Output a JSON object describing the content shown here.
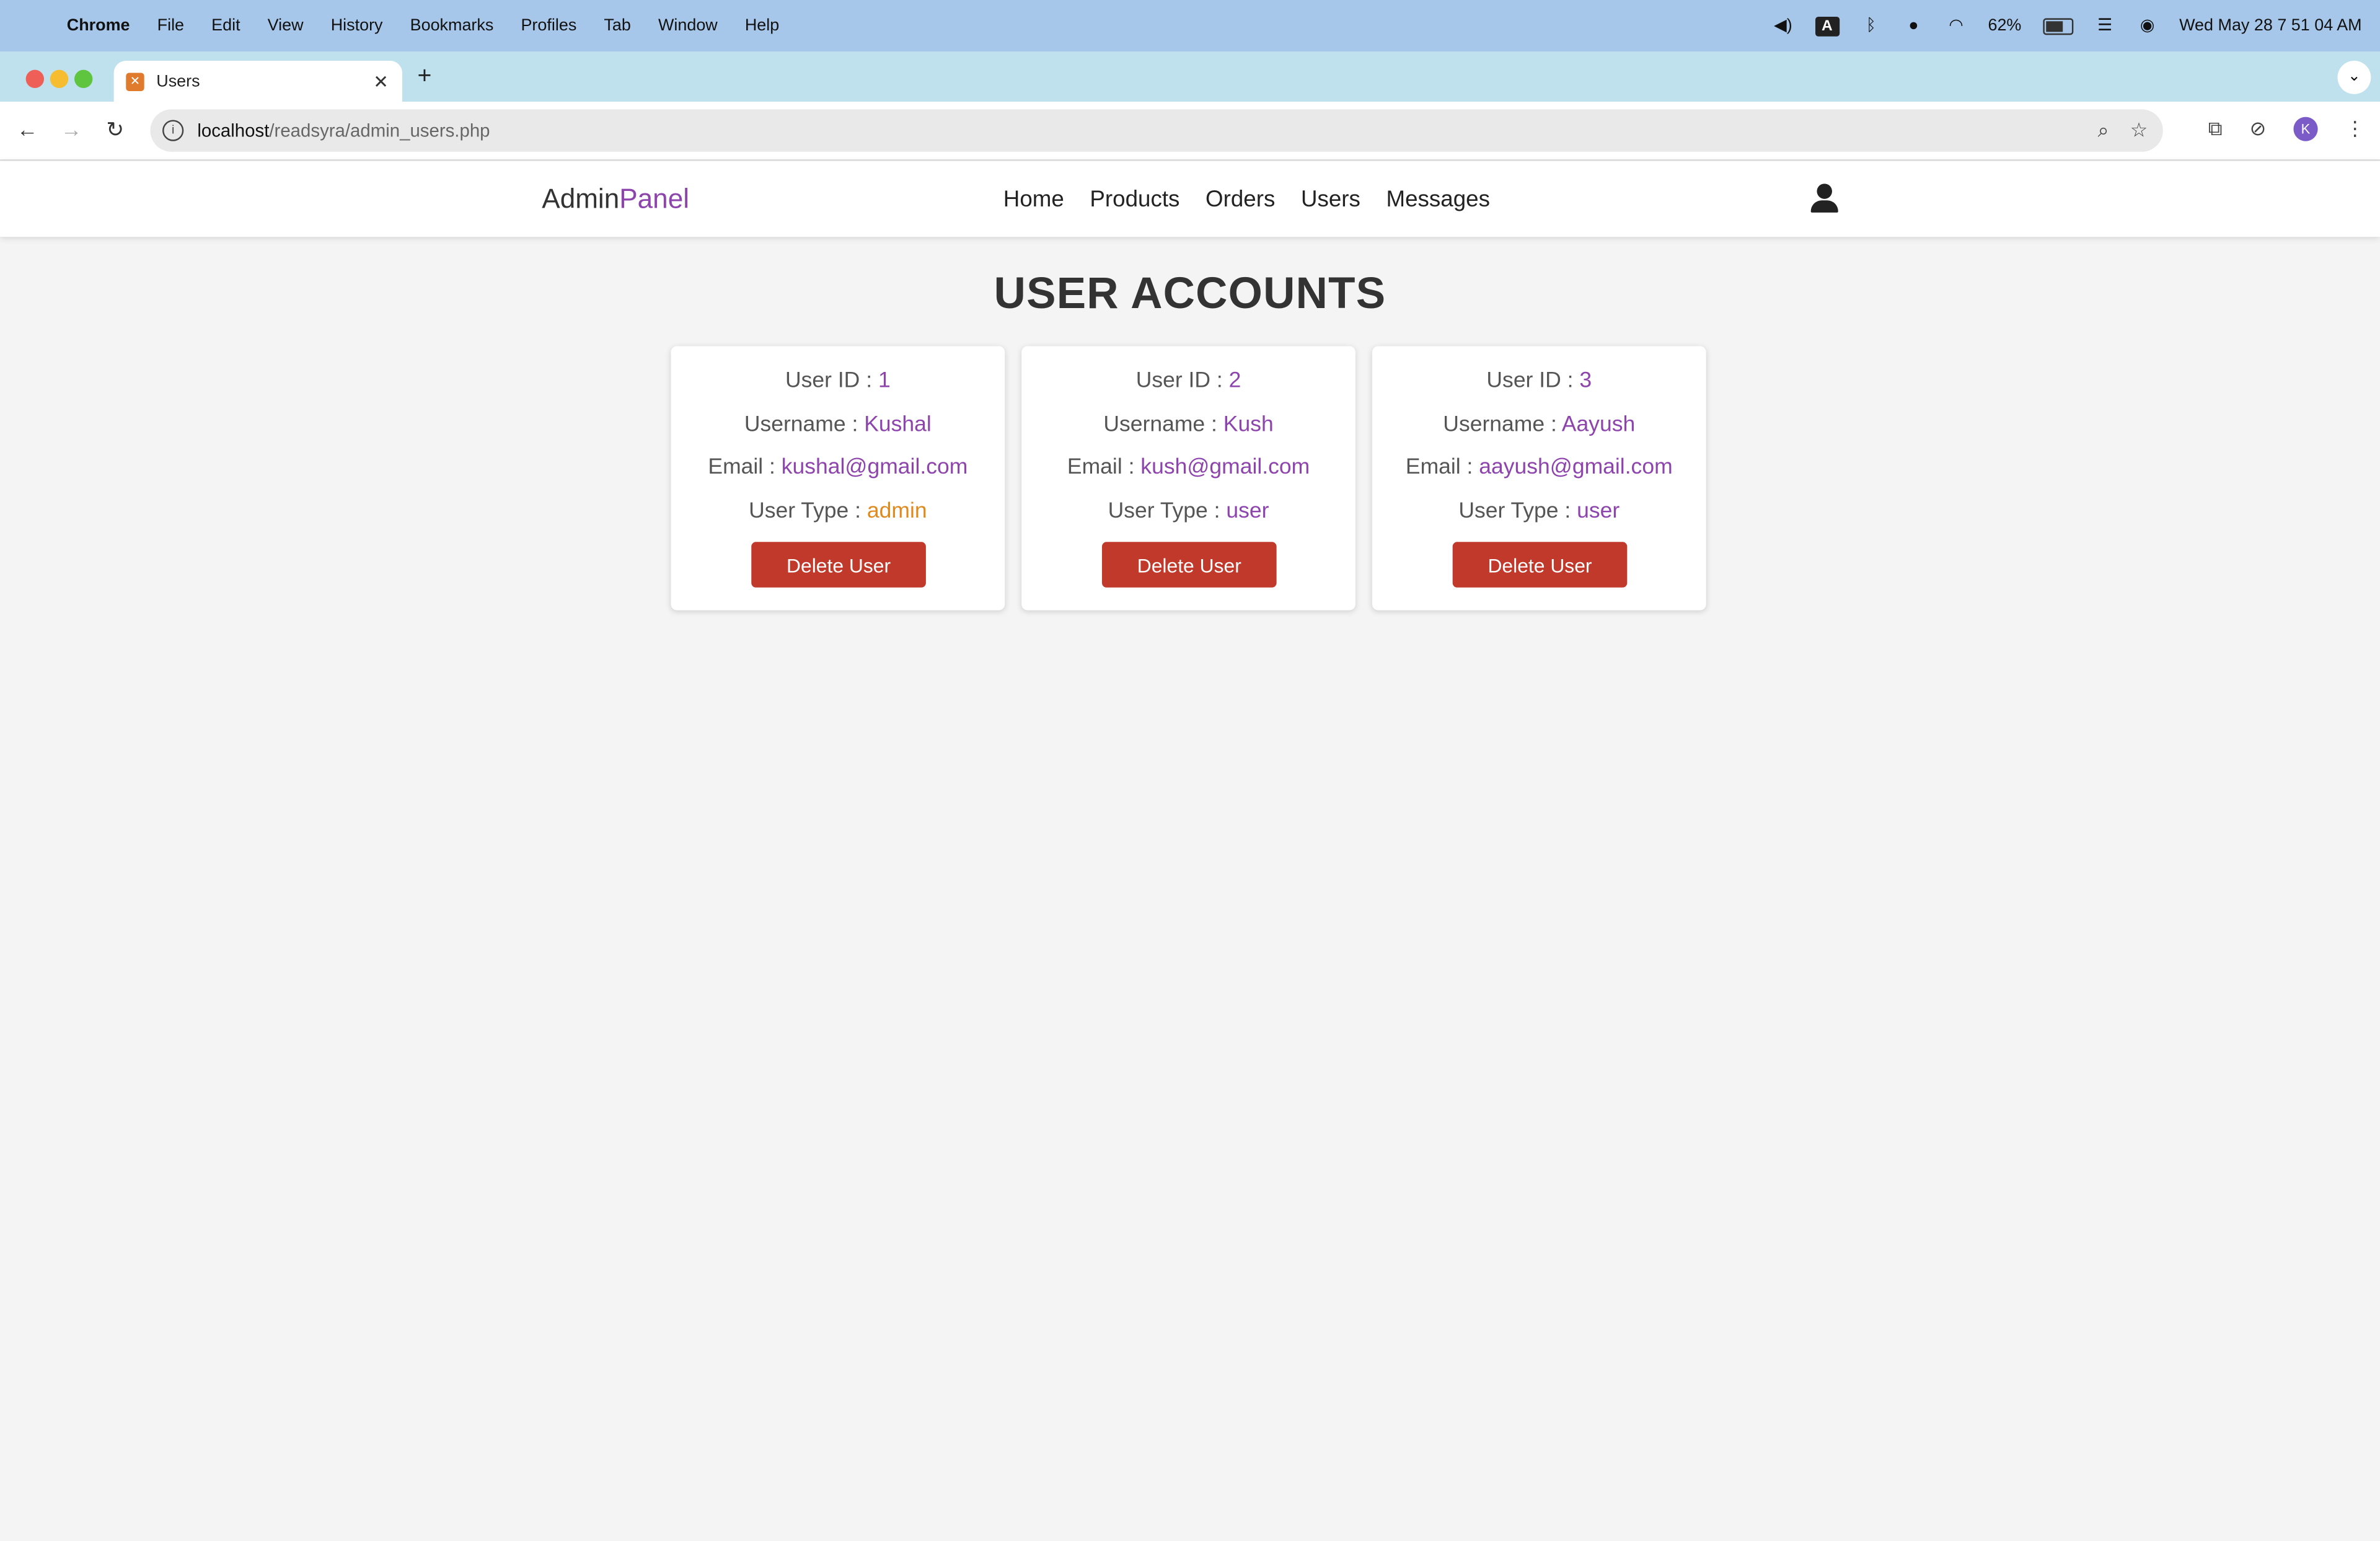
{
  "menubar": {
    "app": "Chrome",
    "items": [
      "File",
      "Edit",
      "View",
      "History",
      "Bookmarks",
      "Profiles",
      "Tab",
      "Window",
      "Help"
    ],
    "battery_percent": "62%",
    "datetime": "Wed May 28  7 51 04 AM"
  },
  "browser": {
    "tab_title": "Users",
    "url_host": "localhost",
    "url_path": "/readsyra/admin_users.php",
    "profile_initial": "K"
  },
  "header": {
    "logo_main": "Admin",
    "logo_accent": "Panel",
    "nav": [
      "Home",
      "Products",
      "Orders",
      "Users",
      "Messages"
    ]
  },
  "page": {
    "title": "USER ACCOUNTS"
  },
  "labels": {
    "user_id": "User ID : ",
    "username": "Username : ",
    "email": "Email : ",
    "user_type": "User Type : ",
    "delete": "Delete User"
  },
  "users": [
    {
      "id": "1",
      "username": "Kushal",
      "email": "kushal@gmail.com",
      "type": "admin"
    },
    {
      "id": "2",
      "username": "Kush",
      "email": "kush@gmail.com",
      "type": "user"
    },
    {
      "id": "3",
      "username": "Aayush",
      "email": "aayush@gmail.com",
      "type": "user"
    }
  ],
  "colors": {
    "accent": "#8e44ad",
    "admin": "#e08a1e",
    "delete": "#c0392b"
  }
}
